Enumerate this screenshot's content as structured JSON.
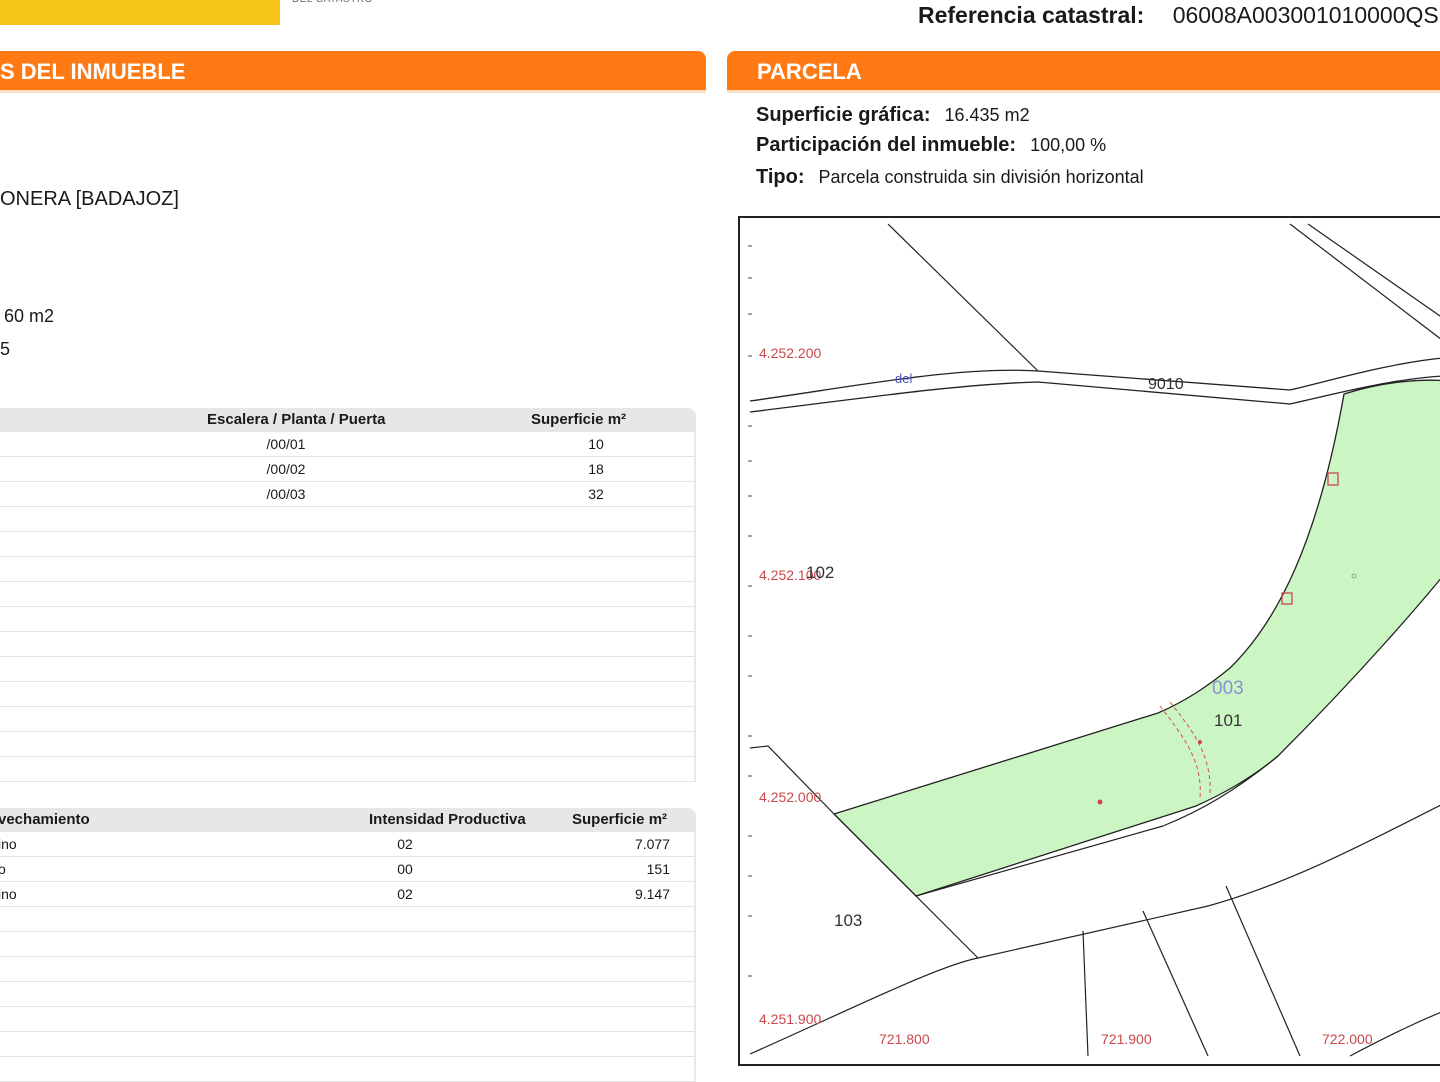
{
  "header": {
    "reference_label": "Referencia catastral:",
    "reference_value": "06008A003001010000QS"
  },
  "left_panel": {
    "title": "S DEL INMUEBLE",
    "location_fragment": "ONERA [BADAJOZ]",
    "surface_fragment": "60 m2",
    "year_fragment": "5",
    "construction_table": {
      "columns": [
        "Escalera / Planta / Puerta",
        "Superficie m²"
      ],
      "rows": [
        {
          "unit": "/00/01",
          "surface": "10"
        },
        {
          "unit": "/00/02",
          "surface": "18"
        },
        {
          "unit": "/00/03",
          "surface": "32"
        }
      ]
    },
    "use_table": {
      "columns": [
        "vechamiento",
        "Intensidad Productiva",
        "Superficie m²"
      ],
      "rows": [
        {
          "use": "ino",
          "intensity": "02",
          "surface": "7.077"
        },
        {
          "use": "o",
          "intensity": "00",
          "surface": "151"
        },
        {
          "use": "ino",
          "intensity": "02",
          "surface": "9.147"
        }
      ]
    }
  },
  "right_panel": {
    "title": "PARCELA",
    "surface_label": "Superficie gráfica:",
    "surface_value": "16.435 m2",
    "share_label": "Participación del inmueble:",
    "share_value": "100,00 %",
    "type_label": "Tipo:",
    "type_value": "Parcela construida sin división horizontal"
  },
  "map": {
    "y_ticks": [
      "4.252.200",
      "4.252.100",
      "4.252.000",
      "4.251.900"
    ],
    "x_ticks": [
      "721.800",
      "721.900",
      "722.000"
    ],
    "road_label": "9010",
    "road_sublabel": "del",
    "polygon_label": "003",
    "parcel_label": "101",
    "neighbor_labels": [
      "102",
      "103"
    ],
    "colors": {
      "parcel_fill": "#ccf5c4",
      "coords": "#c8484c",
      "polygon_label": "#8a8fd6"
    }
  }
}
